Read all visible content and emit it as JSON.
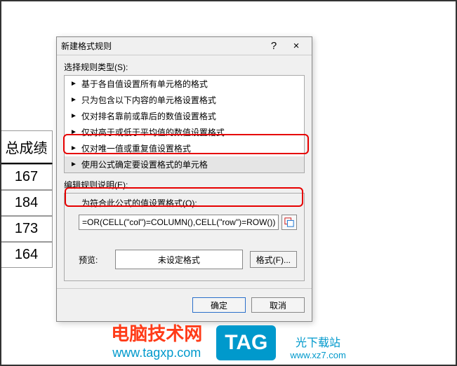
{
  "excel": {
    "header": "总成绩",
    "cells": [
      "167",
      "184",
      "173",
      "164"
    ]
  },
  "dialog": {
    "title": "新建格式规则",
    "help": "?",
    "close": "×",
    "select_rule_type_label": "选择规则类型(S):",
    "rule_types": [
      "基于各自值设置所有单元格的格式",
      "只为包含以下内容的单元格设置格式",
      "仅对排名靠前或靠后的数值设置格式",
      "仅对高于或低于平均值的数值设置格式",
      "仅对唯一值或重复值设置格式",
      "使用公式确定要设置格式的单元格"
    ],
    "edit_rule_label": "编辑规则说明(E):",
    "formula_label": "为符合此公式的值设置格式(O):",
    "formula_value": "=OR(CELL(\"col\")=COLUMN(),CELL(\"row\")=ROW())",
    "preview_label": "预览:",
    "preview_text": "未设定格式",
    "format_btn": "格式(F)...",
    "ok": "确定",
    "cancel": "取消"
  },
  "watermark": {
    "left_title": "电脑技术网",
    "left_url": "www.tagxp.com",
    "tag": "TAG",
    "right_title": "光下载站",
    "right_url": "www.xz7.com"
  }
}
